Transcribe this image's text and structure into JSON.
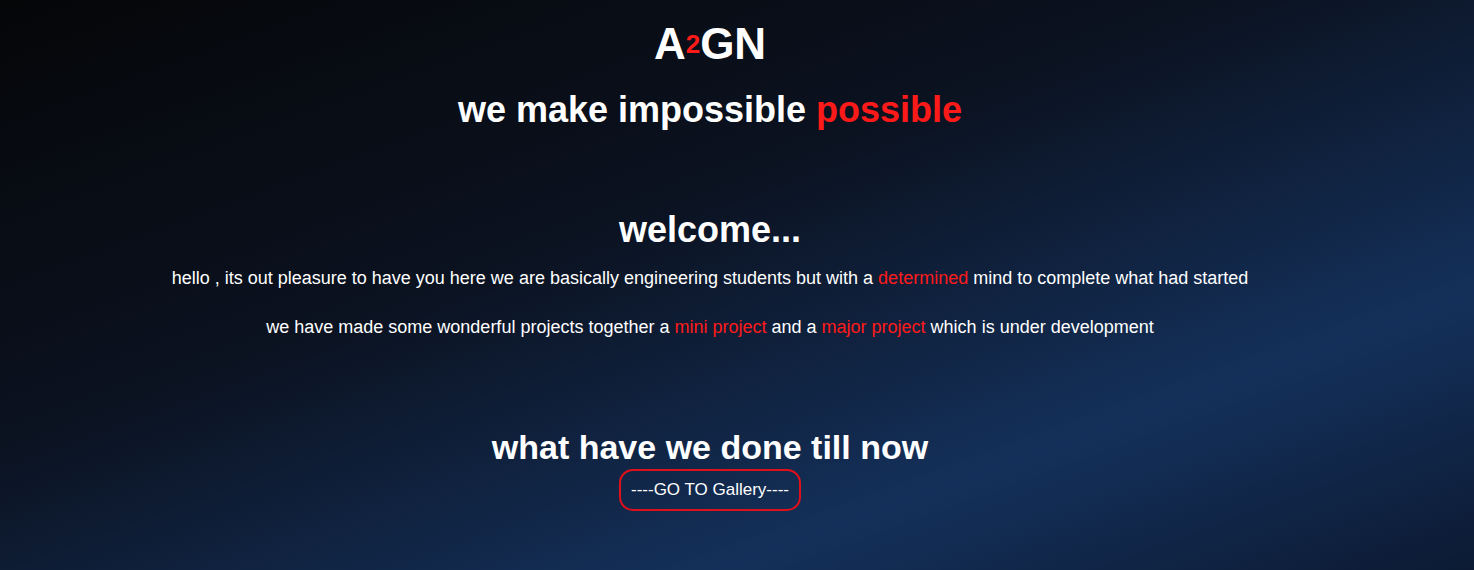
{
  "brand": {
    "parts": [
      {
        "text": "A",
        "sup": false
      },
      {
        "text": "2",
        "sup": true
      },
      {
        "text": "GN",
        "sup": false
      }
    ]
  },
  "tagline": [
    {
      "text": "we make impossible ",
      "highlight": false
    },
    {
      "text": "possible",
      "highlight": true
    }
  ],
  "welcome": {
    "heading": "welcome...",
    "paragraphs": [
      [
        {
          "text": "hello , its out pleasure to have you here we are basically engineering students but with a ",
          "highlight": false
        },
        {
          "text": "determined",
          "highlight": true
        },
        {
          "text": " mind to complete what had started",
          "highlight": false
        }
      ],
      [
        {
          "text": "we have made some wonderful projects together a ",
          "highlight": false
        },
        {
          "text": "mini project",
          "highlight": true
        },
        {
          "text": " and a ",
          "highlight": false
        },
        {
          "text": "major project",
          "highlight": true
        },
        {
          "text": " which is under development",
          "highlight": false
        }
      ]
    ]
  },
  "gallery": {
    "heading": "what have we done till now",
    "button": "----GO TO Gallery----"
  }
}
